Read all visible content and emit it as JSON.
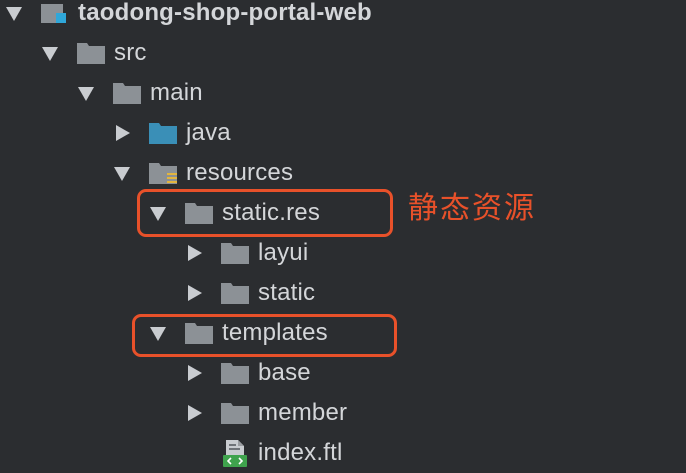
{
  "project_tree": {
    "root": {
      "label": "taodong-shop-portal-web",
      "icon": "module-folder-icon"
    },
    "src": {
      "label": "src",
      "icon": "folder-icon"
    },
    "main": {
      "label": "main",
      "icon": "folder-icon"
    },
    "java": {
      "label": "java",
      "icon": "source-folder-icon"
    },
    "resources": {
      "label": "resources",
      "icon": "resources-folder-icon"
    },
    "static_res": {
      "label": "static.res",
      "icon": "folder-icon"
    },
    "layui": {
      "label": "layui",
      "icon": "folder-icon"
    },
    "static": {
      "label": "static",
      "icon": "folder-icon"
    },
    "templates": {
      "label": "templates",
      "icon": "folder-icon"
    },
    "base": {
      "label": "base",
      "icon": "folder-icon"
    },
    "member": {
      "label": "member",
      "icon": "folder-icon"
    },
    "index_ftl": {
      "label": "index.ftl",
      "icon": "ftl-file-icon"
    }
  },
  "annotation": {
    "text": "静态资源",
    "color": "#e8512a"
  },
  "colors": {
    "background": "#2b2d30",
    "folder": "#8c9196",
    "source_folder": "#3a8fb7",
    "highlight": "#e8512a",
    "file_badge": "#4caf50"
  }
}
